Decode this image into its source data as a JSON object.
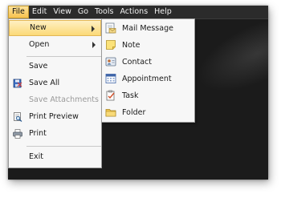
{
  "menubar": {
    "items": [
      "File",
      "Edit",
      "View",
      "Go",
      "Tools",
      "Actions",
      "Help"
    ],
    "active": "File"
  },
  "file_menu": {
    "items": [
      {
        "label": "New",
        "has_submenu": true,
        "highlighted": true,
        "icon": "none"
      },
      {
        "label": "Open",
        "has_submenu": true,
        "icon": "none"
      },
      {
        "label": "Save",
        "icon": "none"
      },
      {
        "label": "Save All",
        "icon": "save-all-icon"
      },
      {
        "label": "Save Attachments",
        "disabled": true,
        "icon": "none"
      },
      {
        "label": "Print Preview",
        "icon": "print-preview-icon"
      },
      {
        "label": "Print",
        "icon": "printer-icon"
      },
      {
        "label": "Exit",
        "icon": "none"
      }
    ]
  },
  "new_submenu": {
    "items": [
      {
        "label": "Mail Message",
        "icon": "mail-message-icon"
      },
      {
        "label": "Note",
        "icon": "note-icon"
      },
      {
        "label": "Contact",
        "icon": "contact-icon"
      },
      {
        "label": "Appointment",
        "icon": "appointment-icon"
      },
      {
        "label": "Task",
        "icon": "task-icon"
      },
      {
        "label": "Folder",
        "icon": "folder-icon"
      }
    ]
  },
  "colors": {
    "menubar_bg": "#2b2b2b",
    "window_bg": "#1b1b1b",
    "highlight": "#fbd977",
    "menu_bg": "#f7f7f7"
  }
}
